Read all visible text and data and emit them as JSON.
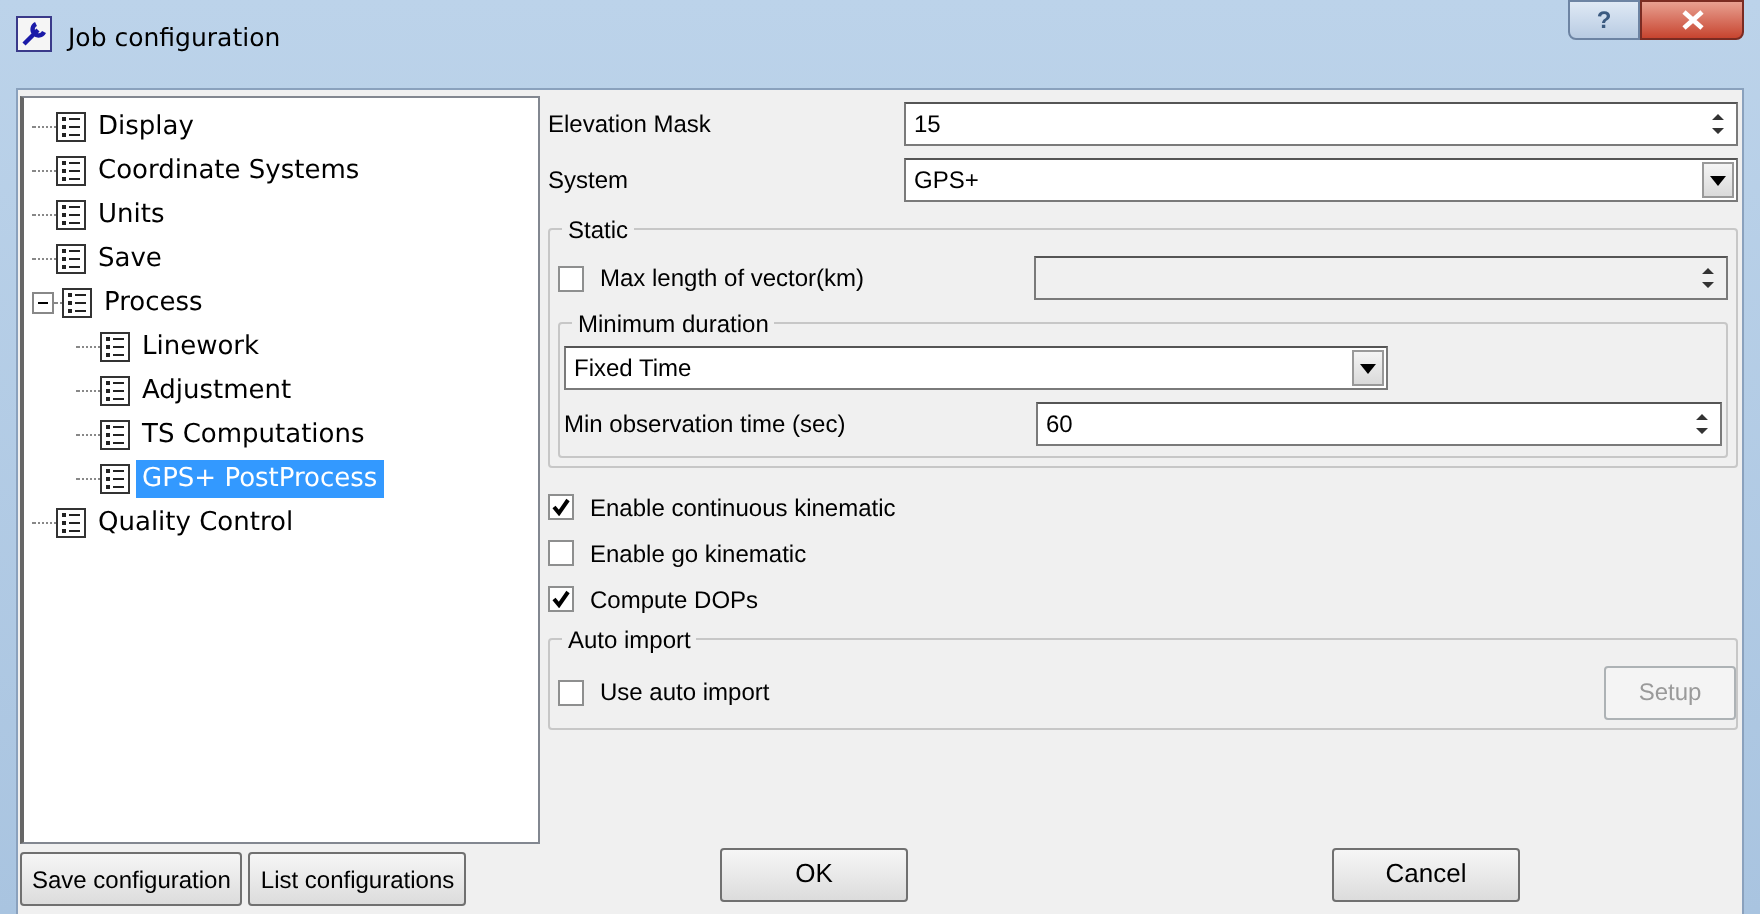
{
  "window": {
    "title": "Job configuration",
    "help_glyph": "?"
  },
  "tree": [
    {
      "label": "Display",
      "selected": false
    },
    {
      "label": "Coordinate Systems",
      "selected": false
    },
    {
      "label": "Units",
      "selected": false
    },
    {
      "label": "Save",
      "selected": false
    },
    {
      "label": "Process",
      "selected": false,
      "expanded": true,
      "children": [
        {
          "label": "Linework",
          "selected": false
        },
        {
          "label": "Adjustment",
          "selected": false
        },
        {
          "label": "TS Computations",
          "selected": false
        },
        {
          "label": "GPS+ PostProcess",
          "selected": true
        }
      ]
    },
    {
      "label": "Quality Control",
      "selected": false
    }
  ],
  "elevation_mask": {
    "label": "Elevation Mask",
    "value": "15"
  },
  "system": {
    "label": "System",
    "value": "GPS+"
  },
  "static": {
    "title": "Static",
    "max_length": {
      "label": "Max length of vector(km)",
      "checked": false,
      "disabled": true
    },
    "minimum_duration": {
      "title": "Minimum duration",
      "mode": "Fixed Time",
      "min_observation": {
        "label": "Min observation time (sec)",
        "value": "60"
      }
    }
  },
  "options": [
    {
      "label": "Enable continuous kinematic",
      "checked": true
    },
    {
      "label": "Enable go kinematic",
      "checked": false
    },
    {
      "label": "Compute DOPs",
      "checked": true
    }
  ],
  "auto_import": {
    "title": "Auto import",
    "checkbox": {
      "label": "Use auto import",
      "checked": false
    },
    "setup_button": {
      "label": "Setup",
      "disabled": true
    }
  },
  "left_buttons": [
    "Save configuration",
    "List configurations"
  ],
  "buttons": [
    "OK",
    "Cancel"
  ]
}
